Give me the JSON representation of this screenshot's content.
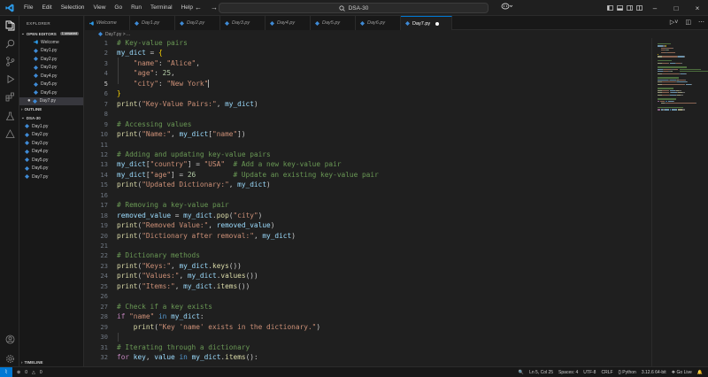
{
  "window": {
    "title": "DSA-30",
    "menu": [
      "File",
      "Edit",
      "Selection",
      "View",
      "Go",
      "Run",
      "Terminal",
      "Help"
    ]
  },
  "sidebar": {
    "title": "EXPLORER",
    "open_editors": {
      "label": "OPEN EDITORS",
      "badge": "1 unsaved",
      "items": [
        "Welcome",
        "Day1.py",
        "Day2.py",
        "Day3.py",
        "Day4.py",
        "Day5.py",
        "Day6.py",
        "Day7.py"
      ]
    },
    "outline_label": "OUTLINE",
    "workspace": {
      "label": "DSA-30",
      "files": [
        "Day1.py",
        "Day2.py",
        "Day3.py",
        "Day4.py",
        "Day5.py",
        "Day6.py",
        "Day7.py"
      ]
    },
    "timeline_label": "TIMELINE"
  },
  "tabs": [
    {
      "label": "Welcome",
      "kind": "vscode"
    },
    {
      "label": "Day1.py",
      "kind": "python"
    },
    {
      "label": "Day2.py",
      "kind": "python"
    },
    {
      "label": "Day3.py",
      "kind": "python"
    },
    {
      "label": "Day4.py",
      "kind": "python"
    },
    {
      "label": "Day5.py",
      "kind": "python"
    },
    {
      "label": "Day6.py",
      "kind": "python"
    },
    {
      "label": "Day7.py",
      "kind": "python",
      "active": true,
      "unsaved": true
    }
  ],
  "breadcrumb": "Day7.py > ...",
  "editor": {
    "current_line": 5,
    "lines": [
      {
        "n": "1",
        "tokens": [
          [
            "comment",
            "# Key-value pairs"
          ]
        ]
      },
      {
        "n": "2",
        "tokens": [
          [
            "var",
            "my_dict"
          ],
          [
            "plain",
            " = "
          ],
          [
            "brace",
            "{"
          ]
        ]
      },
      {
        "n": "3",
        "tokens": [
          [
            "plain",
            "    "
          ],
          [
            "string",
            "\"name\""
          ],
          [
            "plain",
            ": "
          ],
          [
            "string",
            "\"Alice\""
          ],
          [
            "plain",
            ","
          ]
        ]
      },
      {
        "n": "4",
        "tokens": [
          [
            "plain",
            "    "
          ],
          [
            "string",
            "\"age\""
          ],
          [
            "plain",
            ": "
          ],
          [
            "number",
            "25"
          ],
          [
            "plain",
            ","
          ]
        ]
      },
      {
        "n": "5",
        "tokens": [
          [
            "plain",
            "    "
          ],
          [
            "string",
            "\"city\""
          ],
          [
            "plain",
            ": "
          ],
          [
            "string",
            "\"New York\""
          ]
        ],
        "cursor": true
      },
      {
        "n": "6",
        "tokens": [
          [
            "brace",
            "}"
          ]
        ]
      },
      {
        "n": "7",
        "tokens": [
          [
            "func",
            "print"
          ],
          [
            "plain",
            "("
          ],
          [
            "string",
            "\"Key-Value Pairs:\""
          ],
          [
            "plain",
            ", "
          ],
          [
            "var",
            "my_dict"
          ],
          [
            "plain",
            ")"
          ]
        ]
      },
      {
        "n": "8",
        "tokens": []
      },
      {
        "n": "9",
        "tokens": [
          [
            "comment",
            "# Accessing values"
          ]
        ]
      },
      {
        "n": "10",
        "tokens": [
          [
            "func",
            "print"
          ],
          [
            "plain",
            "("
          ],
          [
            "string",
            "\"Name:\""
          ],
          [
            "plain",
            ", "
          ],
          [
            "var",
            "my_dict"
          ],
          [
            "plain",
            "["
          ],
          [
            "string",
            "\"name\""
          ],
          [
            "plain",
            "])"
          ]
        ]
      },
      {
        "n": "11",
        "tokens": []
      },
      {
        "n": "12",
        "tokens": [
          [
            "comment",
            "# Adding and updating key-value pairs"
          ]
        ]
      },
      {
        "n": "13",
        "tokens": [
          [
            "var",
            "my_dict"
          ],
          [
            "plain",
            "["
          ],
          [
            "string",
            "\"country\""
          ],
          [
            "plain",
            "] = "
          ],
          [
            "string",
            "\"USA\""
          ],
          [
            "plain",
            "  "
          ],
          [
            "comment",
            "# Add a new key-value pair"
          ]
        ]
      },
      {
        "n": "14",
        "tokens": [
          [
            "var",
            "my_dict"
          ],
          [
            "plain",
            "["
          ],
          [
            "string",
            "\"age\""
          ],
          [
            "plain",
            "] = "
          ],
          [
            "number",
            "26"
          ],
          [
            "plain",
            "         "
          ],
          [
            "comment",
            "# Update an existing key-value pair"
          ]
        ]
      },
      {
        "n": "15",
        "tokens": [
          [
            "func",
            "print"
          ],
          [
            "plain",
            "("
          ],
          [
            "string",
            "\"Updated Dictionary:\""
          ],
          [
            "plain",
            ", "
          ],
          [
            "var",
            "my_dict"
          ],
          [
            "plain",
            ")"
          ]
        ]
      },
      {
        "n": "16",
        "tokens": []
      },
      {
        "n": "17",
        "tokens": [
          [
            "comment",
            "# Removing a key-value pair"
          ]
        ]
      },
      {
        "n": "18",
        "tokens": [
          [
            "var",
            "removed_value"
          ],
          [
            "plain",
            " = "
          ],
          [
            "var",
            "my_dict"
          ],
          [
            "plain",
            "."
          ],
          [
            "func",
            "pop"
          ],
          [
            "plain",
            "("
          ],
          [
            "string",
            "\"city\""
          ],
          [
            "plain",
            ")"
          ]
        ]
      },
      {
        "n": "19",
        "tokens": [
          [
            "func",
            "print"
          ],
          [
            "plain",
            "("
          ],
          [
            "string",
            "\"Removed Value:\""
          ],
          [
            "plain",
            ", "
          ],
          [
            "var",
            "removed_value"
          ],
          [
            "plain",
            ")"
          ]
        ]
      },
      {
        "n": "20",
        "tokens": [
          [
            "func",
            "print"
          ],
          [
            "plain",
            "("
          ],
          [
            "string",
            "\"Dictionary after removal:\""
          ],
          [
            "plain",
            ", "
          ],
          [
            "var",
            "my_dict"
          ],
          [
            "plain",
            ")"
          ]
        ]
      },
      {
        "n": "21",
        "tokens": []
      },
      {
        "n": "22",
        "tokens": [
          [
            "comment",
            "# Dictionary methods"
          ]
        ]
      },
      {
        "n": "23",
        "tokens": [
          [
            "func",
            "print"
          ],
          [
            "plain",
            "("
          ],
          [
            "string",
            "\"Keys:\""
          ],
          [
            "plain",
            ", "
          ],
          [
            "var",
            "my_dict"
          ],
          [
            "plain",
            "."
          ],
          [
            "func",
            "keys"
          ],
          [
            "plain",
            "())"
          ]
        ]
      },
      {
        "n": "24",
        "tokens": [
          [
            "func",
            "print"
          ],
          [
            "plain",
            "("
          ],
          [
            "string",
            "\"Values:\""
          ],
          [
            "plain",
            ", "
          ],
          [
            "var",
            "my_dict"
          ],
          [
            "plain",
            "."
          ],
          [
            "func",
            "values"
          ],
          [
            "plain",
            "())"
          ]
        ]
      },
      {
        "n": "25",
        "tokens": [
          [
            "func",
            "print"
          ],
          [
            "plain",
            "("
          ],
          [
            "string",
            "\"Items:\""
          ],
          [
            "plain",
            ", "
          ],
          [
            "var",
            "my_dict"
          ],
          [
            "plain",
            "."
          ],
          [
            "func",
            "items"
          ],
          [
            "plain",
            "())"
          ]
        ]
      },
      {
        "n": "26",
        "tokens": []
      },
      {
        "n": "27",
        "tokens": [
          [
            "comment",
            "# Check if a key exists"
          ]
        ]
      },
      {
        "n": "28",
        "tokens": [
          [
            "kw",
            "if"
          ],
          [
            "plain",
            " "
          ],
          [
            "string",
            "\"name\""
          ],
          [
            "plain",
            " "
          ],
          [
            "kw2",
            "in"
          ],
          [
            "plain",
            " "
          ],
          [
            "var",
            "my_dict"
          ],
          [
            "plain",
            ":"
          ]
        ]
      },
      {
        "n": "29",
        "tokens": [
          [
            "plain",
            "    "
          ],
          [
            "func",
            "print"
          ],
          [
            "plain",
            "("
          ],
          [
            "string",
            "\"Key 'name' exists in the dictionary.\""
          ],
          [
            "plain",
            ")"
          ]
        ]
      },
      {
        "n": "30",
        "tokens": []
      },
      {
        "n": "31",
        "tokens": [
          [
            "comment",
            "# Iterating through a dictionary"
          ]
        ]
      },
      {
        "n": "32",
        "tokens": [
          [
            "kw",
            "for"
          ],
          [
            "plain",
            " "
          ],
          [
            "var",
            "key"
          ],
          [
            "plain",
            ", "
          ],
          [
            "var",
            "value"
          ],
          [
            "plain",
            " "
          ],
          [
            "kw2",
            "in"
          ],
          [
            "plain",
            " "
          ],
          [
            "var",
            "my_dict"
          ],
          [
            "plain",
            "."
          ],
          [
            "func",
            "items"
          ],
          [
            "plain",
            "():"
          ]
        ]
      }
    ]
  },
  "statusbar": {
    "errors": "0",
    "warnings": "0",
    "position": "Ln 5, Col 25",
    "spaces": "Spaces: 4",
    "encoding": "UTF-8",
    "eol": "CRLF",
    "language": "Python",
    "interpreter": "3.12.6 64-bit",
    "live": "Go Live"
  },
  "colors": {
    "accent": "#0078d4",
    "python_icon": "#3e8ad6",
    "comment": "#6a9955",
    "string": "#ce9178",
    "number": "#b5cea8",
    "function": "#dcdcaa",
    "variable": "#9cdcfe",
    "keyword": "#c586c0"
  }
}
